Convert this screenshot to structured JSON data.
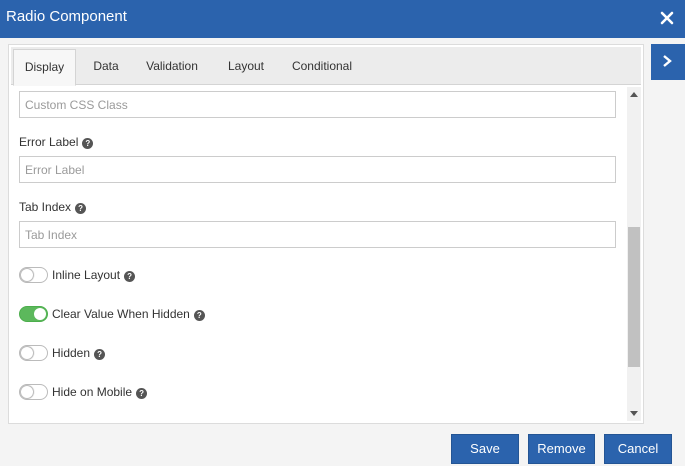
{
  "dialog": {
    "title": "Radio Component",
    "close_icon": "close-icon",
    "side_tab_icon": "chevron-right-icon"
  },
  "tabs": [
    {
      "label": "Display",
      "active": true
    },
    {
      "label": "Data",
      "active": false
    },
    {
      "label": "Validation",
      "active": false
    },
    {
      "label": "Layout",
      "active": false
    },
    {
      "label": "Conditional",
      "active": false
    }
  ],
  "fields": {
    "custom_css": {
      "placeholder": "Custom CSS Class",
      "value": ""
    },
    "error_label": {
      "label": "Error Label",
      "placeholder": "Error Label",
      "value": ""
    },
    "tab_index": {
      "label": "Tab Index",
      "placeholder": "Tab Index",
      "value": ""
    }
  },
  "toggles": [
    {
      "label": "Inline Layout",
      "checked": false
    },
    {
      "label": "Clear Value When Hidden",
      "checked": true
    },
    {
      "label": "Hidden",
      "checked": false
    },
    {
      "label": "Hide on Mobile",
      "checked": false
    }
  ],
  "footer": {
    "save_label": "Save",
    "remove_label": "Remove",
    "cancel_label": "Cancel"
  },
  "colors": {
    "primary": "#2b63ad",
    "toggle_on": "#5cb85c"
  }
}
